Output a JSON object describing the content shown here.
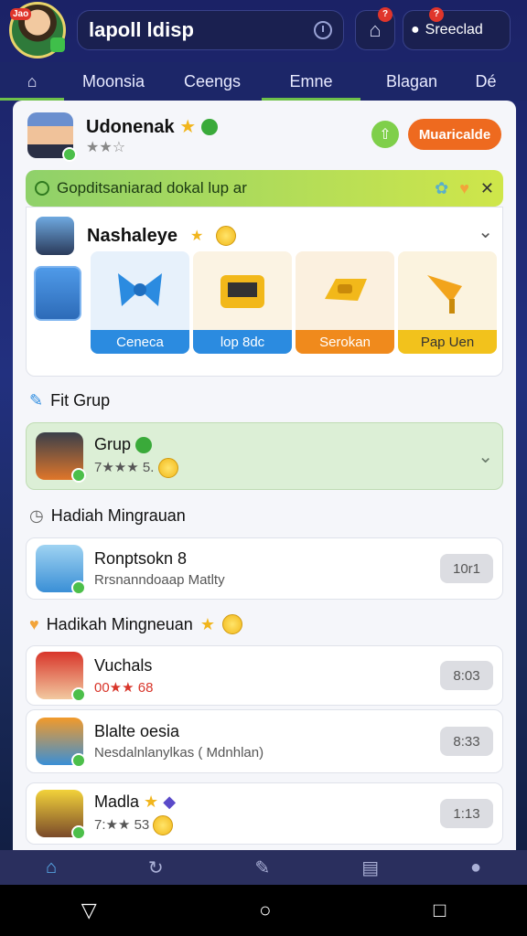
{
  "header": {
    "avatar_badge": "Jao",
    "title": "lapoll ldisp",
    "home_notif": "?",
    "user_notif": "?",
    "user_label": "Sreeclad"
  },
  "tabs": [
    {
      "label": "Moonsia"
    },
    {
      "label": "Ceengs"
    },
    {
      "label": "Emne"
    },
    {
      "label": "Blagan"
    },
    {
      "label": "Dé"
    }
  ],
  "profile": {
    "name": "Udonenak",
    "stars": "★★☆",
    "action_label": "Muaricalde"
  },
  "banner": {
    "text": "Gopditsaniarad dokal lup ar"
  },
  "rewards_section": {
    "name": "Nashaleye",
    "items": [
      {
        "label": "Ceneca",
        "color": "#2b8be0"
      },
      {
        "label": "lop 8dc",
        "color": "#2b8be0"
      },
      {
        "label": "Serokan",
        "color": "#f08a1c"
      },
      {
        "label": "Pap Uen",
        "color": "#f2c21c"
      }
    ]
  },
  "fit_group": {
    "heading": "Fit Grup",
    "item": {
      "name": "Grup",
      "stars": "7★★★ 5."
    }
  },
  "weekly1": {
    "heading": "Hadiah Mingrauan",
    "item": {
      "title": "Ronptsokn 8",
      "subtitle": "Rrsnanndoaap Matlty",
      "time": "10r1"
    }
  },
  "weekly2": {
    "heading": "Hadikah Mingneuan",
    "items": [
      {
        "title": "Vuchals",
        "subtitle": "00★★ 68",
        "time": "8:03"
      },
      {
        "title": "Blalte oesia",
        "subtitle": "Nesdalnlanylkas ( Mdnhlan)",
        "time": "8:33"
      },
      {
        "title": "Madla",
        "subtitle": "7:★★ 53",
        "time": "1:13"
      }
    ]
  }
}
